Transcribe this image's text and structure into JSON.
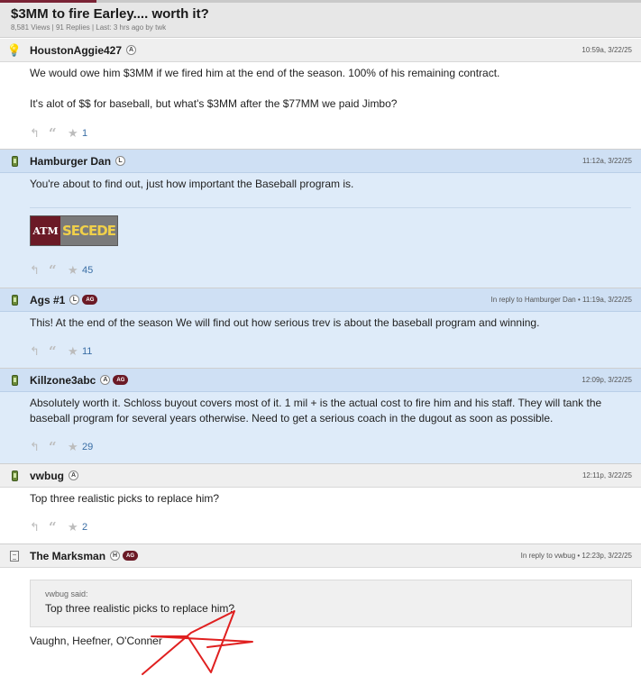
{
  "thread": {
    "title": "$3MM to fire Earley.... worth it?",
    "meta": "8,581 Views | 91 Replies | Last: 3 hrs ago by twk"
  },
  "posts": [
    {
      "username": "HoustonAggie427",
      "badges": [
        "A"
      ],
      "timestamp": "10:59a, 3/22/25",
      "lines": [
        "We would owe him $3MM if we fired him at the end of the season. 100% of his remaining contract.",
        "It's alot of $$ for baseball, but what's $3MM after the $77MM we paid Jimbo?"
      ],
      "stars": "1"
    },
    {
      "username": "Hamburger Dan",
      "badges": [
        "L"
      ],
      "timestamp": "11:12a, 3/22/25",
      "lines": [
        "You're about to find out, just how important the Baseball program is."
      ],
      "signature_logo": {
        "left": "ATM",
        "right": "SECEDE"
      },
      "stars": "45"
    },
    {
      "username": "Ags #1",
      "badges": [
        "L",
        "AG"
      ],
      "timestamp": "In reply to Hamburger Dan • 11:19a, 3/22/25",
      "lines": [
        "This! At the end of the season We will find out how serious trev is about the baseball program and winning."
      ],
      "stars": "11"
    },
    {
      "username": "Killzone3abc",
      "badges": [
        "A",
        "AG"
      ],
      "timestamp": "12:09p, 3/22/25",
      "lines": [
        "Absolutely worth it. Schloss buyout covers most of it. 1 mil + is the actual cost to fire him and his staff. They will tank the",
        "baseball program for several years otherwise. Need to get a serious coach in the dugout as soon as possible."
      ],
      "stars": "29"
    },
    {
      "username": "vwbug",
      "badges": [
        "A"
      ],
      "timestamp": "12:11p, 3/22/25",
      "lines": [
        "Top three realistic picks to replace him?"
      ],
      "stars": "2"
    },
    {
      "username": "The Marksman",
      "badges": [
        "H",
        "AG"
      ],
      "timestamp": "In reply to vwbug • 12:23p, 3/22/25",
      "quote": {
        "author": "vwbug said:",
        "text": "Top three realistic picks to replace him?"
      },
      "lines": [
        "Vaughn, Heefner, O'Conner"
      ]
    }
  ],
  "icons": {
    "device_phone": "mobile-phone-icon",
    "device_bulb": "lightbulb-icon",
    "device_doc": "document-icon",
    "reply": "reply-icon",
    "quote": "quote-icon",
    "star": "star-icon"
  },
  "colors": {
    "maroon": "#6b1a26",
    "blue_post": "#deebf9",
    "link_blue": "#3a6ea5",
    "annotation_red": "#e02020"
  }
}
